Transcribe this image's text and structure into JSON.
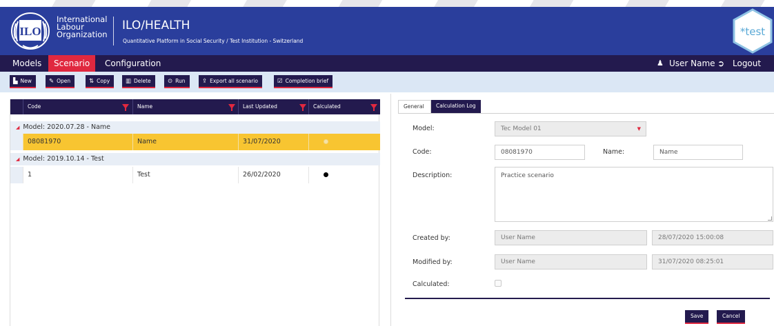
{
  "brand": {
    "org_lines": [
      "International",
      "Labour",
      "Organization"
    ],
    "logo_text": "ILO",
    "app_title": "ILO/HEALTH",
    "app_subtitle": "Quantitative Platform in Social Security / Test Institution - Switzerland",
    "badge": "*test",
    "colors": {
      "header": "#2a3e9c",
      "navy": "#231a4e",
      "accent": "#e0283f",
      "selected": "#f8c531",
      "toolbar": "#dbe7f5"
    }
  },
  "menu": {
    "items": [
      {
        "label": "Models",
        "active": false
      },
      {
        "label": "Scenario",
        "active": true
      },
      {
        "label": "Configuration",
        "active": false
      }
    ],
    "user_icon": "user-icon",
    "user_name": "User Name",
    "logout_icon": "sign-out-icon",
    "logout": "Logout"
  },
  "toolbar": [
    {
      "icon": "file-icon",
      "glyph": "▙",
      "label": "New"
    },
    {
      "icon": "pencil-icon",
      "glyph": "✎",
      "label": "Open"
    },
    {
      "icon": "copy-icon",
      "glyph": "⇅",
      "label": "Copy"
    },
    {
      "icon": "trash-icon",
      "glyph": "▥",
      "label": "Delete"
    },
    {
      "icon": "play-circle-icon",
      "glyph": "⊙",
      "label": "Run"
    },
    {
      "icon": "export-icon",
      "glyph": "⇪",
      "label": "Export all scenario"
    },
    {
      "icon": "checklist-icon",
      "glyph": "☑",
      "label": "Completion brief"
    }
  ],
  "grid": {
    "columns": [
      "Code",
      "Name",
      "Last Updated",
      "Calculated"
    ],
    "groups": [
      {
        "label": "Model: 2020.07.28 - Name",
        "rows": [
          {
            "code": "08081970",
            "name": "Name",
            "updated": "31/07/2020",
            "calculated": false,
            "selected": true
          }
        ]
      },
      {
        "label": "Model: 2019.10.14 - Test",
        "rows": [
          {
            "code": "1",
            "name": "Test",
            "updated": "26/02/2020",
            "calculated": true,
            "selected": false
          }
        ]
      }
    ]
  },
  "detail": {
    "tabs": [
      {
        "label": "General",
        "active": true
      },
      {
        "label": "Calculation Log",
        "active": false
      }
    ],
    "labels": {
      "model": "Model:",
      "code": "Code:",
      "name": "Name:",
      "description": "Description:",
      "created_by": "Created by:",
      "modified_by": "Modified by:",
      "calculated": "Calculated:"
    },
    "values": {
      "model": "Tec Model 01",
      "code": "08081970",
      "name": "Name",
      "description": "Practice scenario",
      "created_by": "User Name",
      "created_at": "28/07/2020 15:00:08",
      "modified_by": "User Name",
      "modified_at": "31/07/2020 08:25:01",
      "calculated": false
    },
    "save": "Save",
    "cancel": "Cancel"
  }
}
